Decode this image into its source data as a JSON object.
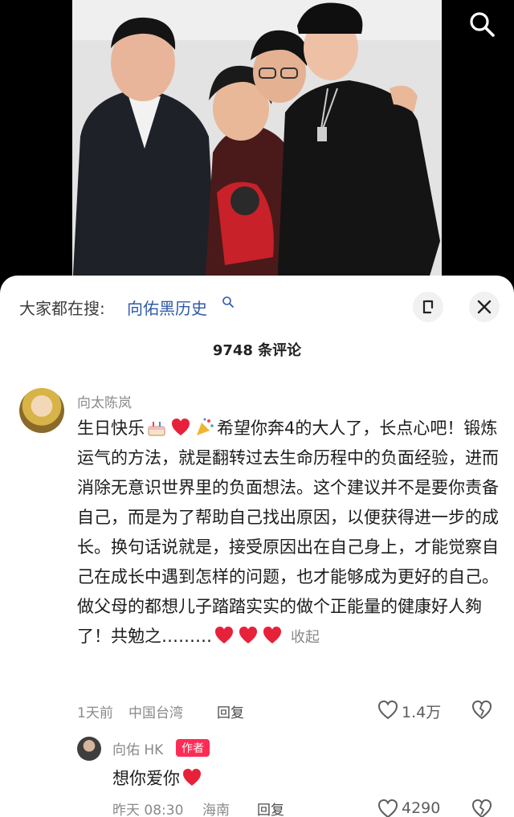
{
  "search_panel": {
    "trending_label": "大家都在搜:",
    "trending_query": "向佑黑历史"
  },
  "comments_header": {
    "count": "9748 条评论"
  },
  "comment": {
    "author": "向太陈岚",
    "text_parts": [
      "生日快乐",
      "希望你奔4的大人了，长点心吧！锻炼运气的方法，就是翻转过去生命历程中的负面经验，进而消除无意识世界里的负面想法。这个建议并不是要你责备自己，而是为了帮助自己找出原因，以便获得进一步的成长。换句话说就是，接受原因出在自己身上，才能觉察自己在成长中遇到怎样的问题，也才能够成为更好的自己。做父母的都想儿子踏踏实实的做个正能量的健康好人夠了！共勉之………"
    ],
    "collapse_label": "收起",
    "time": "1天前",
    "location": "中国台湾",
    "reply_label": "回复",
    "likes": "1.4万"
  },
  "reply": {
    "author": "向佑 HK",
    "badge": "作者",
    "text": "想你爱你",
    "time": "昨天 08:30",
    "location": "海南",
    "reply_label": "回复",
    "likes": "4290"
  },
  "colors": {
    "link": "#2f5aa8",
    "author_badge": "#fe2c55",
    "heart": "#e8213a"
  },
  "icons": [
    "search-icon",
    "trending-search-icon",
    "minimize-icon",
    "close-icon",
    "cake-icon",
    "heart-icon",
    "party-popper-icon",
    "like-icon",
    "dislike-icon"
  ]
}
